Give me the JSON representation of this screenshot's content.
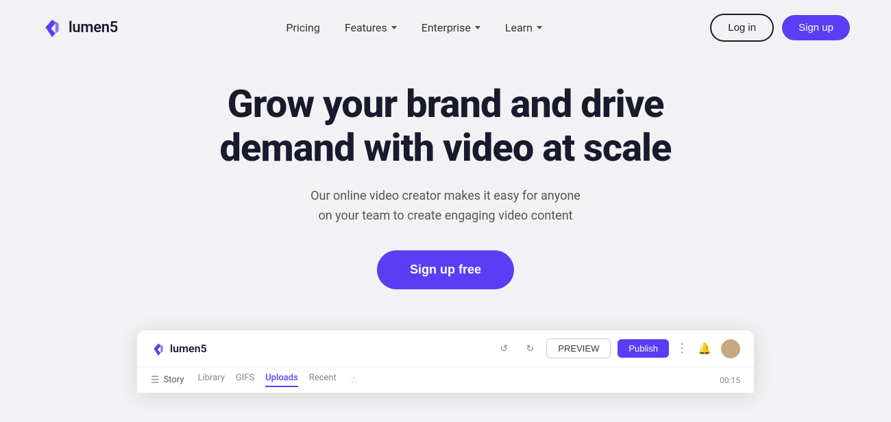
{
  "brand": {
    "name": "lumen5",
    "logo_color": "#5b3df5"
  },
  "nav": {
    "items": [
      {
        "label": "Pricing",
        "has_dropdown": false
      },
      {
        "label": "Features",
        "has_dropdown": true
      },
      {
        "label": "Enterprise",
        "has_dropdown": true
      },
      {
        "label": "Learn",
        "has_dropdown": true
      }
    ],
    "login_label": "Log in",
    "signup_label": "Sign up"
  },
  "hero": {
    "title_line1": "Grow your brand and drive",
    "title_line2": "demand with video at scale",
    "subtitle_line1": "Our online video creator makes it easy for anyone",
    "subtitle_line2": "on your team to create engaging video content",
    "cta_label": "Sign up free"
  },
  "app_preview": {
    "logo_text": "lumen5",
    "preview_btn": "PREVIEW",
    "publish_btn": "Publish",
    "story_label": "Story",
    "tabs": [
      "Library",
      "GIFS",
      "Uploads",
      "Recent"
    ],
    "active_tab": "Uploads",
    "time": "00:15"
  }
}
